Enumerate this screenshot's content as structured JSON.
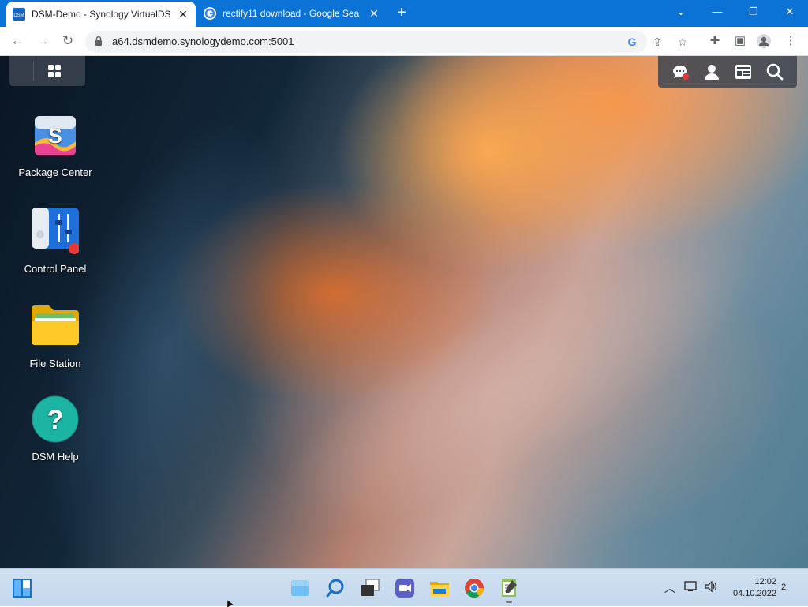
{
  "browser": {
    "tabs": [
      {
        "title": "DSM-Demo - Synology VirtualDS",
        "favicon": "dsm-favicon",
        "favicon_text": "DSM",
        "active": true
      },
      {
        "title": "rectify11 download - Google Sea",
        "favicon": "google-favicon",
        "active": false
      }
    ],
    "new_tab": "+",
    "url": "a64.dsmdemo.synologydemo.com:5001",
    "window_controls": {
      "dropdown": "⌄",
      "minimize": "—",
      "restore": "❐",
      "close": "✕"
    }
  },
  "dsm": {
    "desktop_icons": [
      {
        "label": "Package Center",
        "icon": "package-center-icon"
      },
      {
        "label": "Control Panel",
        "icon": "control-panel-icon"
      },
      {
        "label": "File Station",
        "icon": "file-station-icon"
      },
      {
        "label": "DSM Help",
        "icon": "dsm-help-icon"
      }
    ],
    "top_right_icons": [
      "notifications-icon",
      "user-icon",
      "widgets-icon",
      "search-icon"
    ],
    "accent": "#e53935"
  },
  "taskbar": {
    "apps": [
      "start-icon",
      "widgets-icon",
      "search-icon",
      "task-view-icon",
      "meet-icon",
      "file-explorer-icon",
      "chrome-icon",
      "notepad-icon"
    ],
    "time": "12:02",
    "date": "04.10.2022",
    "notifications": "2"
  }
}
